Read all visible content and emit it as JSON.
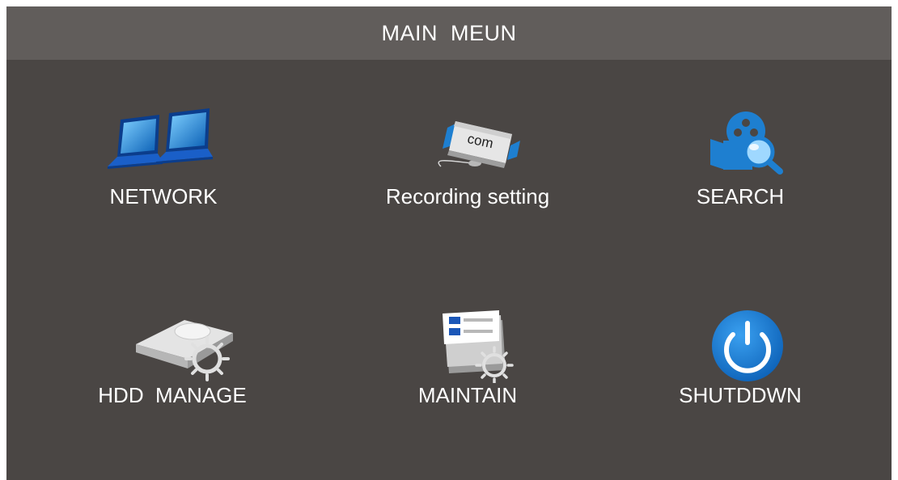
{
  "window": {
    "title": "MAIN  MEUN"
  },
  "menu": {
    "items": [
      {
        "label": "NETWORK",
        "icon": "network-icon"
      },
      {
        "label": "Recording setting",
        "icon": "recording-setting-icon",
        "icon_text": "com"
      },
      {
        "label": "SEARCH",
        "icon": "search-icon"
      },
      {
        "label": "HDD  MANAGE",
        "icon": "hdd-manage-icon"
      },
      {
        "label": "MAINTAIN",
        "icon": "maintain-icon"
      },
      {
        "label": "SHUTDDWN",
        "icon": "power-icon"
      }
    ]
  },
  "colors": {
    "background": "#4a4644",
    "titlebar": "#615d5b",
    "text": "#ffffff",
    "accent_blue": "#1e7fd0"
  }
}
